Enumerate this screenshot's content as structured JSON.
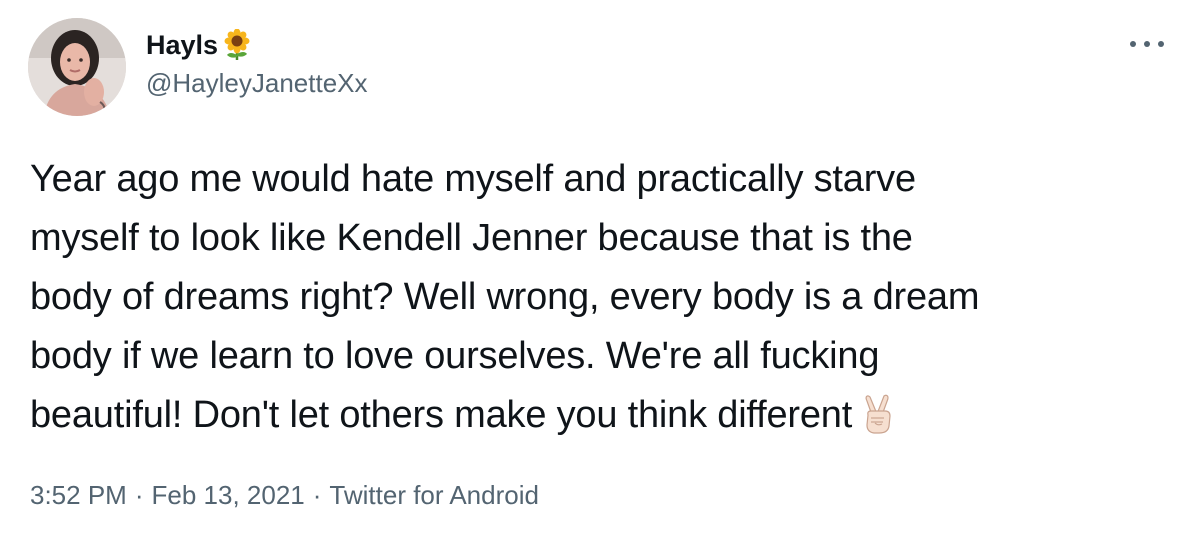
{
  "author": {
    "display_name": "Hayls",
    "handle": "@HayleyJanetteXx",
    "name_emoji": "sunflower-icon",
    "avatar": "avatar"
  },
  "tweet": {
    "text": "Year ago me would hate myself and practically starve\nmyself to look like Kendell Jenner because that is the\nbody of dreams right? Well wrong, every body is a dream\nbody if we learn to love ourselves. We're all fucking\nbeautiful! Don't let others make you think different",
    "trailing_emoji": "victory-hand-icon"
  },
  "meta": {
    "time": "3:52 PM",
    "separator": "·",
    "date": "Feb 13, 2021",
    "source": "Twitter for Android"
  },
  "menu": {
    "icon": "more-options-icon"
  },
  "colors": {
    "text_primary": "#0f1419",
    "text_secondary": "#536471",
    "background": "#ffffff"
  }
}
